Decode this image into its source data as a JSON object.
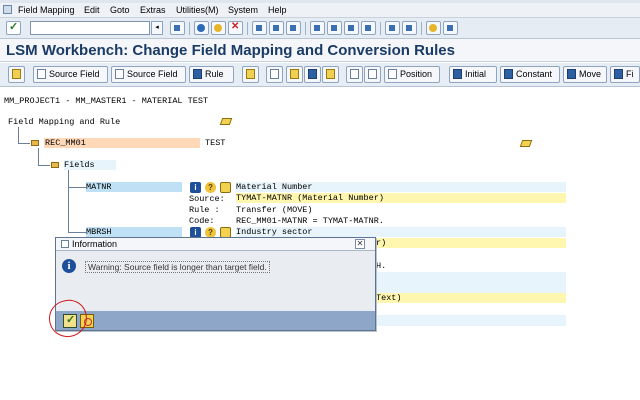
{
  "menubar": {
    "items": [
      "Field Mapping",
      "Edit",
      "Goto",
      "Extras",
      "Utilities(M)",
      "System",
      "Help"
    ]
  },
  "title": "LSM Workbench: Change Field Mapping and Conversion Rules",
  "app_toolbar": {
    "buttons": [
      "Source Field",
      "Source Field",
      "Rule",
      "Position",
      "Initial",
      "Constant",
      "Move",
      "Fi"
    ]
  },
  "tree": {
    "project": "MM_PROJECT1 - MM_MASTER1 - MATERIAL TEST",
    "root": "Field Mapping and Rule",
    "structure_name": "REC_MM01",
    "structure_desc": "TEST",
    "fields_label": "Fields",
    "field1": {
      "name": "MATNR",
      "desc": "Material Number",
      "source_label": "Source:",
      "source_value": "TYMAT-MATNR (Material Number)",
      "rule_label": "Rule :",
      "rule_value": "Transfer (MOVE)",
      "code_label": "Code:",
      "code_value": "REC_MM01-MATNR = TYMAT-MATNR."
    },
    "field2": {
      "name": "MBRSH",
      "desc": "Industry sector",
      "partial1": "r)",
      "partial2": "H.",
      "partial3": "Text)"
    }
  },
  "dialog": {
    "title": "Information",
    "message": "Warning: Source field is longer than target field.",
    "close_glyph": "✕"
  },
  "colors": {
    "title_text": "#1a3b66",
    "highlight_yellow": "#fff7b0",
    "highlight_blue": "#bfe0f5",
    "highlight_orange": "#ffd8b8",
    "annotation_red": "#d01818",
    "dialog_footer": "#8ea7c9"
  }
}
